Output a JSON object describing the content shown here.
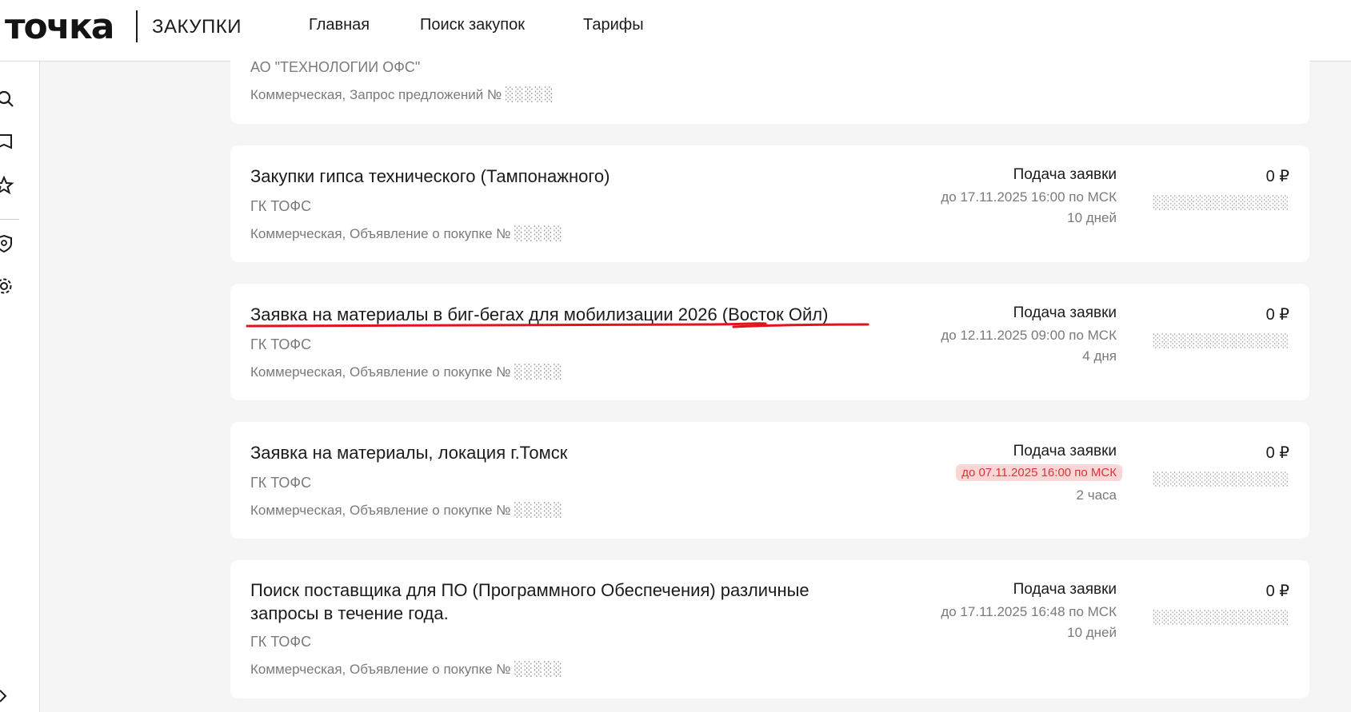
{
  "header": {
    "logo": "точка",
    "logo_sub": "ЗАКУПКИ",
    "nav": [
      "Главная",
      "Поиск закупок",
      "Тарифы"
    ]
  },
  "sidebar": {
    "icons": [
      "search-icon",
      "book-icon",
      "star-icon",
      "shield-icon",
      "gear-icon",
      "expand-icon"
    ]
  },
  "top_card": {
    "org": "АО \"ТЕХНОЛОГИИ ОФС\"",
    "type": "Коммерческая, Запрос предложений №",
    "number": "░░░░░"
  },
  "cards": [
    {
      "title": "Закупки гипса технического (Тампонажного)",
      "org": "ГК ТОФС",
      "type": "Коммерческая, Объявление о покупке №",
      "number": "░░░░░",
      "deadline_label": "Подача заявки",
      "deadline": "до 17.11.2025 16:00 по МСК",
      "time_left": "10 дней",
      "price": "0 ₽",
      "price_sub": "░░░░░░░░░░░░░░░░"
    },
    {
      "title": "Заявка на материалы в биг-бегах для мобилизации 2026 (Восток Ойл)",
      "org": "ГК ТОФС",
      "type": "Коммерческая, Объявление о покупке №",
      "number": "░░░░░",
      "deadline_label": "Подача заявки",
      "deadline": "до 12.11.2025 09:00 по МСК",
      "time_left": "4 дня",
      "price": "0 ₽",
      "price_sub": "░░░░░░░░░░░░░░░░"
    },
    {
      "title": "Заявка на материалы, локация г.Томск",
      "org": "ГК ТОФС",
      "type": "Коммерческая, Объявление о покупке №",
      "number": "░░░░░",
      "deadline_label": "Подача заявки",
      "deadline": "до 07.11.2025 16:00 по МСК",
      "time_left": "2 часа",
      "price": "0 ₽",
      "price_sub": "░░░░░░░░░░░░░░░░"
    },
    {
      "title": "Поиск поставщика для ПО (Программного Обеспечения) различные запросы в течение года.",
      "org": "ГК ТОФС",
      "type": "Коммерческая, Объявление о покупке №",
      "number": "░░░░░",
      "deadline_label": "Подача заявки",
      "deadline": "до 17.11.2025 16:48 по МСК",
      "time_left": "10 дней",
      "price": "0 ₽",
      "price_sub": "░░░░░░░░░░░░░░░░"
    }
  ],
  "colors": {
    "urgent_bg": "#fbd6d6",
    "urgent_text": "#d8343a",
    "annotation": "#e3121c"
  }
}
